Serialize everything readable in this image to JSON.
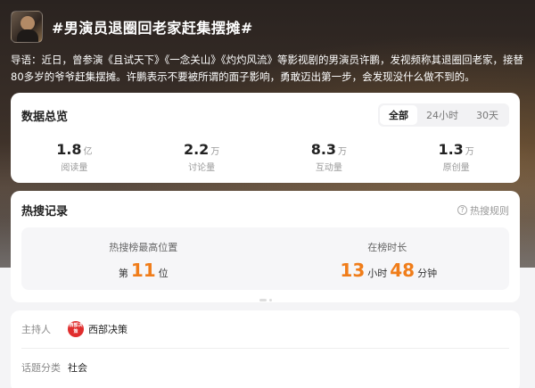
{
  "topic": {
    "title": "#男演员退圈回老家赶集摆摊#",
    "intro": "导语：近日，曾参演《且试天下》《一念关山》《灼灼风流》等影视剧的男演员许鹏，发视频称其退圈回老家，接替80多岁的爷爷赶集摆摊。许鹏表示不要被所谓的面子影响，勇敢迈出第一步，会发现没什么做不到的。"
  },
  "overview": {
    "title": "数据总览",
    "tabs": [
      {
        "label": "全部",
        "active": true
      },
      {
        "label": "24小时",
        "active": false
      },
      {
        "label": "30天",
        "active": false
      }
    ],
    "stats": [
      {
        "value": "1.8",
        "unit": "亿",
        "label": "阅读量"
      },
      {
        "value": "2.2",
        "unit": "万",
        "label": "讨论量"
      },
      {
        "value": "8.3",
        "unit": "万",
        "label": "互动量"
      },
      {
        "value": "1.3",
        "unit": "万",
        "label": "原创量"
      }
    ]
  },
  "hot": {
    "title": "热搜记录",
    "rules_label": "热搜规则",
    "peak": {
      "label": "热搜榜最高位置",
      "prefix": "第",
      "value": "11",
      "suffix": "位"
    },
    "duration": {
      "label": "在榜时长",
      "hours": "13",
      "hours_unit": "小时",
      "minutes": "48",
      "minutes_unit": "分钟"
    }
  },
  "info": {
    "host_label": "主持人",
    "host_name": "西部决策",
    "host_logo_text": "西部决策",
    "category_label": "话题分类",
    "category_value": "社会"
  },
  "colors": {
    "accent_orange": "#f07d1a",
    "host_logo_red": "#e02d2d"
  }
}
